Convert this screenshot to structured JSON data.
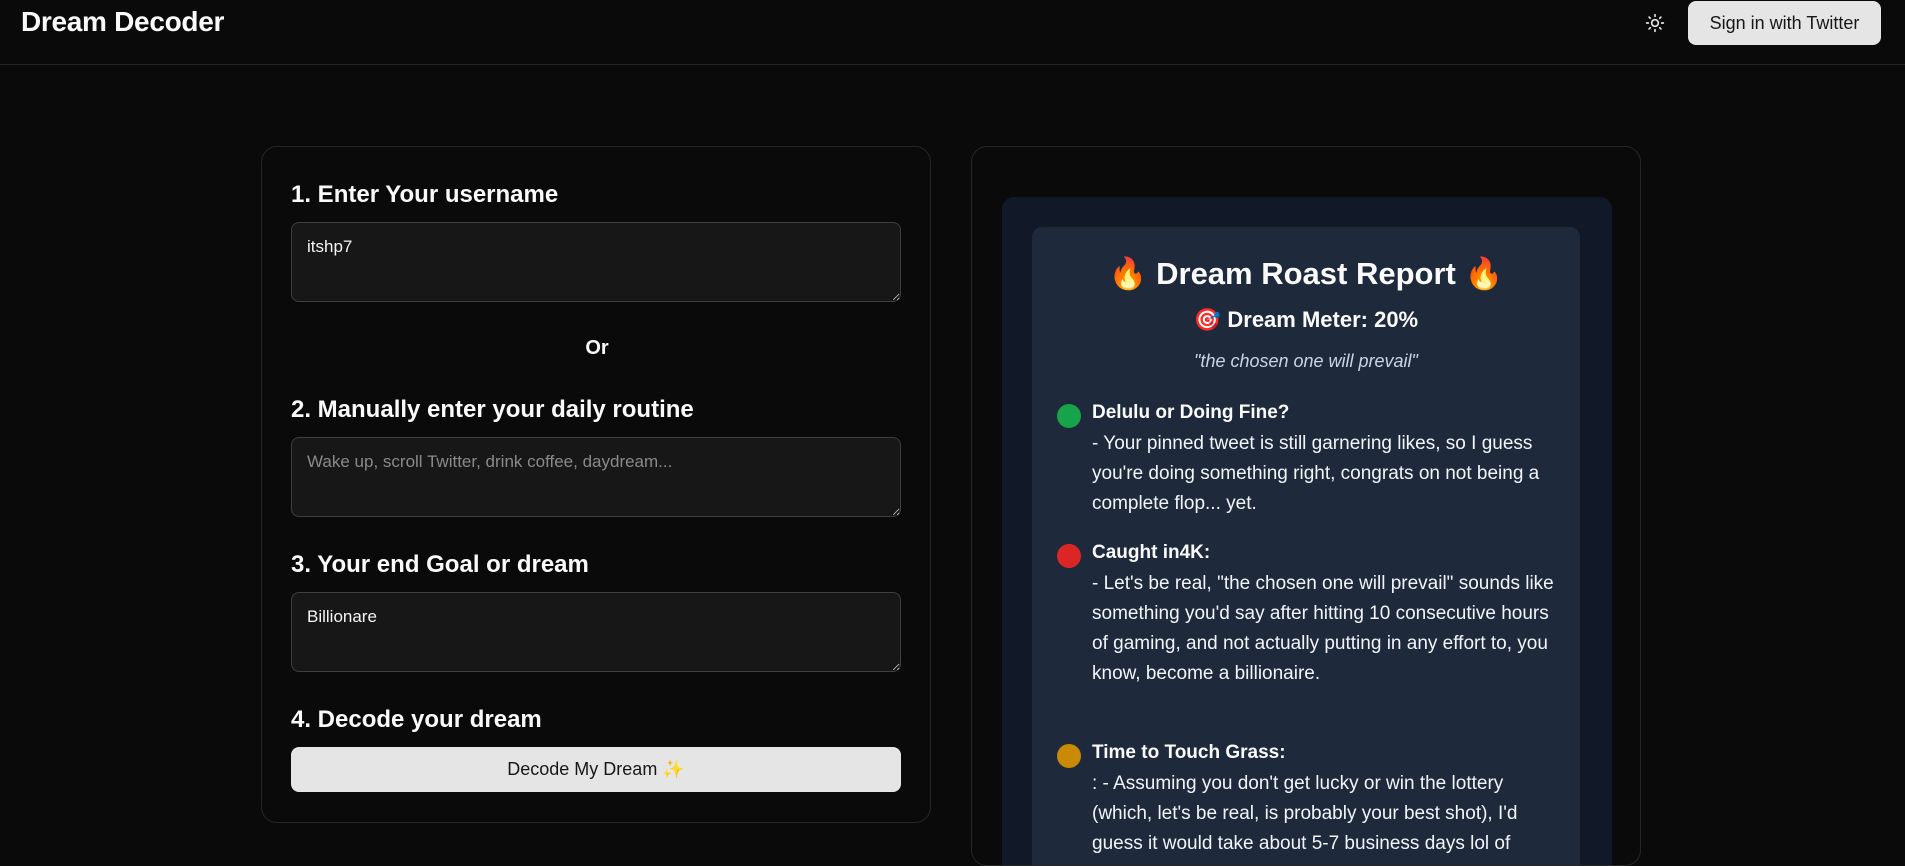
{
  "header": {
    "brand": "Dream Decoder",
    "theme_icon": "sun-icon",
    "signin_label": "Sign in with Twitter"
  },
  "form": {
    "step1_label": "1. Enter Your username",
    "username_value": "itshp7",
    "or_label": "Or",
    "step2_label": "2. Manually enter your daily routine",
    "routine_value": "",
    "routine_placeholder": "Wake up, scroll Twitter, drink coffee, daydream...",
    "step3_label": "3. Your end Goal or dream",
    "goal_value": "Billionare",
    "step4_label": "4. Decode your dream",
    "decode_label": "Decode My Dream ✨"
  },
  "report": {
    "title": "🔥 Dream Roast Report 🔥",
    "meter": "🎯 Dream Meter: 20%",
    "meter_value": 20,
    "quote": "\"the chosen one will prevail\"",
    "items": [
      {
        "color": "#16a34a",
        "heading": "Delulu or Doing Fine?",
        "body": "- Your pinned tweet is still garnering likes, so I guess you're doing something right, congrats on not being a complete flop... yet."
      },
      {
        "color": "#dc2626",
        "heading": "Caught in4K:",
        "body": "- Let's be real, \"the chosen one will prevail\" sounds like something you'd say after hitting 10 consecutive hours of gaming, and not actually putting in any effort to, you know, become a billionaire."
      },
      {
        "color": "#ca8a04",
        "heading": "Time to Touch Grass:",
        "body": ": - Assuming you don't get lucky or win the lottery (which, let's be real, is probably your best shot), I'd guess it would take about 5-7 business days lol of"
      }
    ]
  }
}
